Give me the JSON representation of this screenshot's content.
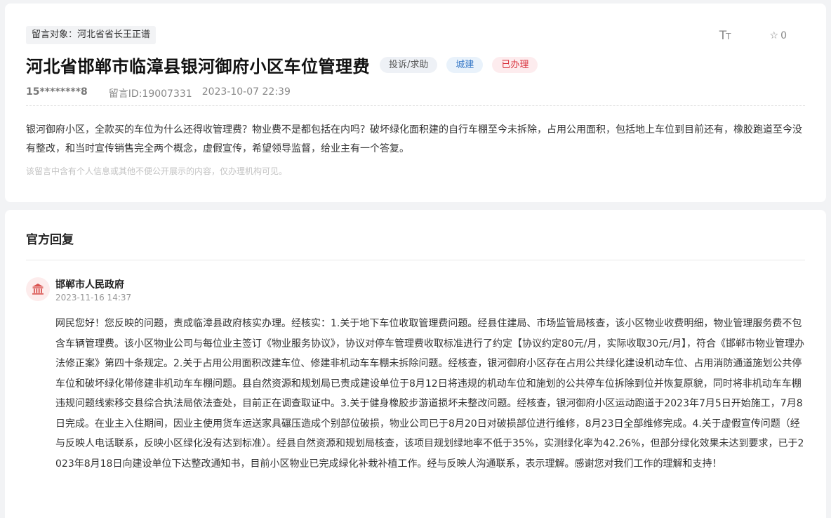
{
  "message": {
    "target_label": "留言对象：河北省省长王正谱",
    "title": "河北省邯郸市临漳县银河御府小区车位管理费",
    "badges": [
      "投诉/求助",
      "城建",
      "已办理"
    ],
    "user": "15********8",
    "message_id": "留言ID:19007331",
    "datetime": "2023-10-07 22:39",
    "content": "银河御府小区，全款买的车位为什么还得收管理费？物业费不是都包括在内吗？破坏绿化面积建的自行车棚至今未拆除，占用公用面积，包括地上车位到目前还有，橡胶跑道至今没有整改，和当时宣传销售完全两个概念，虚假宣传，希望领导监督，给业主有一个答复。",
    "privacy_notice": "该留言中含有个人信息或其他不便公开展示的内容，仅办理机构可见。"
  },
  "tools": {
    "font_icon_text": "TT",
    "star_icon": "☆",
    "star_count": "0"
  },
  "reply": {
    "heading": "官方回复",
    "department": "邯郸市人民政府",
    "datetime": "2023-11-16 14:37",
    "content": "网民您好！您反映的问题，责成临漳县政府核实办理。经核实：1.关于地下车位收取管理费问题。经县住建局、市场监管局核查，该小区物业收费明细，物业管理服务费不包含车辆管理费。该小区物业公司与每位业主签订《物业服务协议》，协议对停车管理费收取标准进行了约定【协议约定80元/月，实际收取30元/月】，符合《邯郸市物业管理办法修正案》第四十条规定。2.关于占用公用面积改建车位、修建非机动车车棚未拆除问题。经核查，银河御府小区存在占用公共绿化建设机动车位、占用消防通道施划公共停车位和破坏绿化带修建非机动车车棚问题。县自然资源和规划局已责成建设单位于8月12日将违规的机动车位和施划的公共停车位拆除到位并恢复原貌，同时将非机动车车棚违规问题线索移交县综合执法局依法查处，目前正在调查取证中。3.关于健身橡胶步游道损坏未整改问题。经核查，银河御府小区运动跑道于2023年7月5日开始施工，7月8日完成。在业主入住期间，因业主使用货车运送家具碾压造成个别部位破损，物业公司已于8月20日对破损部位进行维修，8月23日全部维修完成。4.关于虚假宣传问题（经与反映人电话联系，反映小区绿化没有达到标准）。经县自然资源和规划局核查，该项目规划绿地率不低于35%，实测绿化率为42.26%，但部分绿化效果未达到要求，已于2023年8月18日向建设单位下达整改通知书，目前小区物业已完成绿化补栽补植工作。经与反映人沟通联系，表示理解。感谢您对我们工作的理解和支持！"
  },
  "colors": {
    "badge_type": "#eef1f6",
    "badge_category_text": "#3a7bc8",
    "badge_status_text": "#d9343f",
    "gov_icon": "#d9534f"
  }
}
